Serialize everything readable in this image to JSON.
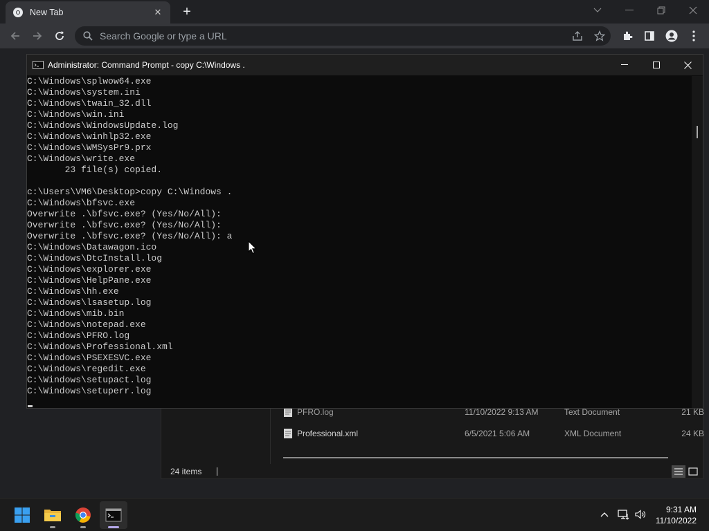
{
  "browser": {
    "tab_title": "New Tab",
    "omnibox_placeholder": "Search Google or type a URL"
  },
  "explorer": {
    "files": [
      {
        "name": "PFRO.log",
        "date": "11/10/2022 9:13 AM",
        "type": "Text Document",
        "size": "21 KB"
      },
      {
        "name": "Professional.xml",
        "date": "6/5/2021 5:06 AM",
        "type": "XML Document",
        "size": "24 KB"
      }
    ],
    "status": "24 items"
  },
  "cmd": {
    "title": "Administrator: Command Prompt - copy  C:\\Windows .",
    "lines": [
      "C:\\Windows\\splwow64.exe",
      "C:\\Windows\\system.ini",
      "C:\\Windows\\twain_32.dll",
      "C:\\Windows\\win.ini",
      "C:\\Windows\\WindowsUpdate.log",
      "C:\\Windows\\winhlp32.exe",
      "C:\\Windows\\WMSysPr9.prx",
      "C:\\Windows\\write.exe",
      "       23 file(s) copied.",
      "",
      "c:\\Users\\VM6\\Desktop>copy C:\\Windows .",
      "C:\\Windows\\bfsvc.exe",
      "Overwrite .\\bfsvc.exe? (Yes/No/All):",
      "Overwrite .\\bfsvc.exe? (Yes/No/All):",
      "Overwrite .\\bfsvc.exe? (Yes/No/All): a",
      "C:\\Windows\\Datawagon.ico",
      "C:\\Windows\\DtcInstall.log",
      "C:\\Windows\\explorer.exe",
      "C:\\Windows\\HelpPane.exe",
      "C:\\Windows\\hh.exe",
      "C:\\Windows\\lsasetup.log",
      "C:\\Windows\\mib.bin",
      "C:\\Windows\\notepad.exe",
      "C:\\Windows\\PFRO.log",
      "C:\\Windows\\Professional.xml",
      "C:\\Windows\\PSEXESVC.exe",
      "C:\\Windows\\regedit.exe",
      "C:\\Windows\\setupact.log",
      "C:\\Windows\\setuperr.log"
    ]
  },
  "taskbar": {
    "time": "9:31 AM",
    "date": "11/10/2022"
  },
  "colors": {
    "accent": "#b4a7e8",
    "console_text": "#cccccc",
    "console_bg": "#0c0c0c"
  }
}
